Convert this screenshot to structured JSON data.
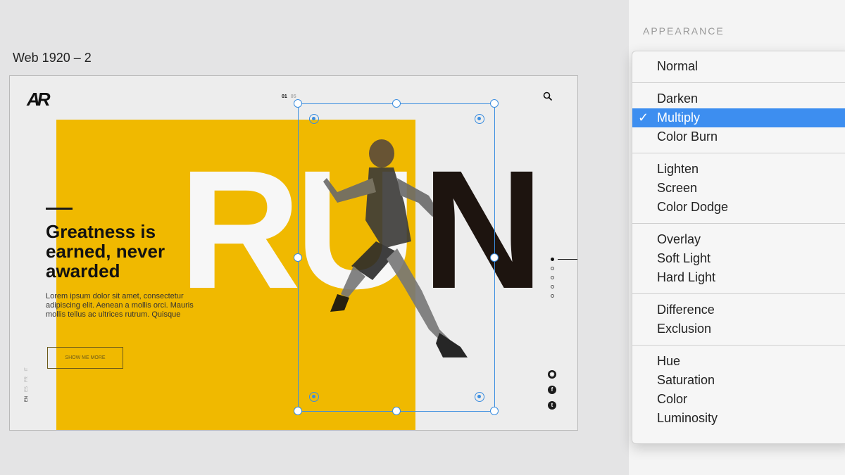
{
  "artboard": {
    "title": "Web 1920 – 2",
    "logo": "AR",
    "pager_current": "01",
    "pager_total": "05",
    "big_word": {
      "r": "R",
      "u": "U",
      "n": "N"
    },
    "headline": "Greatness is earned, never awarded",
    "body": "Lorem ipsum dolor sit amet, consectetur adipiscing elit. Aenean a mollis orci. Mauris mollis tellus ac ultrices rutrum. Quisque",
    "button_label": "SHOW ME MORE",
    "languages": [
      "EN",
      "ES",
      "FR",
      "IT"
    ],
    "slide_count": 5,
    "social": [
      "instagram-icon",
      "facebook-icon",
      "twitter-icon"
    ],
    "colors": {
      "accent": "#f0b900",
      "dark": "#1d140f",
      "selection": "#3a8de0"
    }
  },
  "panel": {
    "heading": "APPEARANCE",
    "groups": [
      [
        {
          "label": "Normal"
        }
      ],
      [
        {
          "label": "Darken"
        },
        {
          "label": "Multiply",
          "selected": true
        },
        {
          "label": "Color Burn"
        }
      ],
      [
        {
          "label": "Lighten"
        },
        {
          "label": "Screen"
        },
        {
          "label": "Color Dodge"
        }
      ],
      [
        {
          "label": "Overlay"
        },
        {
          "label": "Soft Light"
        },
        {
          "label": "Hard Light"
        }
      ],
      [
        {
          "label": "Difference"
        },
        {
          "label": "Exclusion"
        }
      ],
      [
        {
          "label": "Hue"
        },
        {
          "label": "Saturation"
        },
        {
          "label": "Color"
        },
        {
          "label": "Luminosity"
        }
      ]
    ],
    "check_mark": "✓",
    "highlight_color": "#3d8ef0"
  }
}
